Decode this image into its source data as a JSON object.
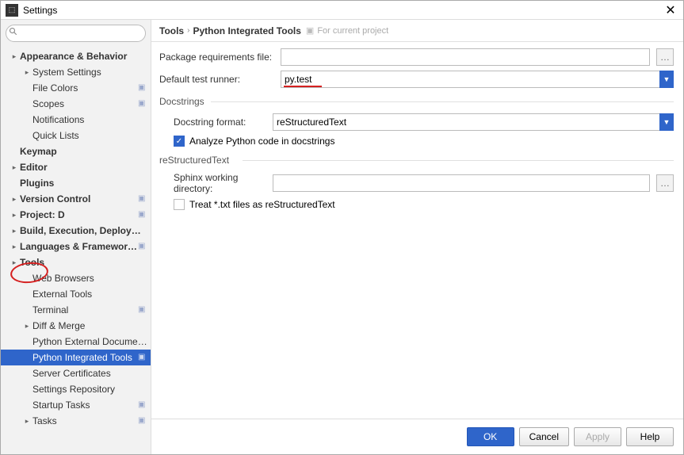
{
  "window": {
    "title": "Settings"
  },
  "breadcrumb": {
    "part1": "Tools",
    "part2": "Python Integrated Tools",
    "scope": "For current project"
  },
  "sidebar": {
    "items": [
      {
        "label": "Appearance & Behavior",
        "bold": true,
        "arrow": true
      },
      {
        "label": "System Settings",
        "child": true,
        "arrow": true
      },
      {
        "label": "File Colors",
        "child": true,
        "grandchild": true,
        "badge": true
      },
      {
        "label": "Scopes",
        "child": true,
        "grandchild": true,
        "badge": true
      },
      {
        "label": "Notifications",
        "child": true,
        "grandchild": true
      },
      {
        "label": "Quick Lists",
        "child": true,
        "grandchild": true
      },
      {
        "label": "Keymap",
        "bold": true
      },
      {
        "label": "Editor",
        "bold": true,
        "arrow": true
      },
      {
        "label": "Plugins",
        "bold": true
      },
      {
        "label": "Version Control",
        "bold": true,
        "arrow": true,
        "badge": true
      },
      {
        "label": "Project: D",
        "bold": true,
        "arrow": true,
        "badge": true
      },
      {
        "label": "Build, Execution, Deployment",
        "bold": true,
        "arrow": true
      },
      {
        "label": "Languages & Frameworks",
        "bold": true,
        "arrow": true,
        "badge": true
      },
      {
        "label": "Tools",
        "bold": true,
        "arrow": true
      },
      {
        "label": "Web Browsers",
        "child": true,
        "grandchild": true
      },
      {
        "label": "External Tools",
        "child": true,
        "grandchild": true
      },
      {
        "label": "Terminal",
        "child": true,
        "grandchild": true,
        "badge": true
      },
      {
        "label": "Diff & Merge",
        "child": true,
        "arrow": true
      },
      {
        "label": "Python External Documentatic",
        "child": true,
        "grandchild": true
      },
      {
        "label": "Python Integrated Tools",
        "child": true,
        "grandchild": true,
        "badge": true,
        "selected": true
      },
      {
        "label": "Server Certificates",
        "child": true,
        "grandchild": true
      },
      {
        "label": "Settings Repository",
        "child": true,
        "grandchild": true
      },
      {
        "label": "Startup Tasks",
        "child": true,
        "grandchild": true,
        "badge": true
      },
      {
        "label": "Tasks",
        "child": true,
        "arrow": true,
        "badge": true
      }
    ]
  },
  "form": {
    "pkg_label": "Package requirements file:",
    "pkg_value": "",
    "runner_label": "Default test runner:",
    "runner_value": "py.test",
    "docstrings_title": "Docstrings",
    "docformat_label": "Docstring format:",
    "docformat_value": "reStructuredText",
    "analyze_label": "Analyze Python code in docstrings",
    "rst_title": "reStructuredText",
    "sphinx_label": "Sphinx working directory:",
    "sphinx_value": "",
    "treat_label": "Treat *.txt files as reStructuredText"
  },
  "buttons": {
    "ok": "OK",
    "cancel": "Cancel",
    "apply": "Apply",
    "help": "Help"
  },
  "browse_glyph": "…"
}
